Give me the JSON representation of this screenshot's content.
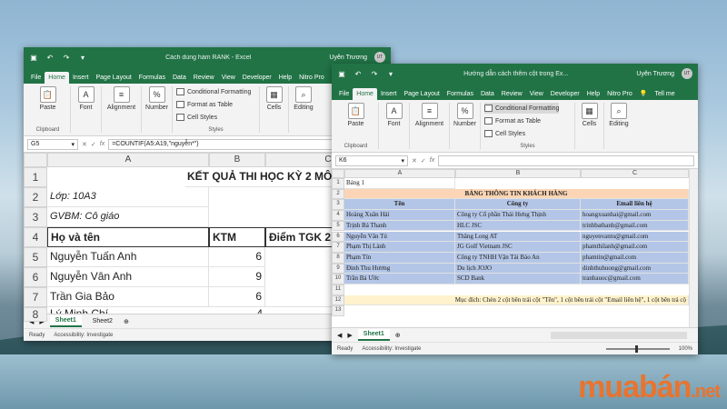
{
  "win1": {
    "title": "Cách dùng hàm RANK  -  Excel",
    "user": "Uyên Trương",
    "avatar": "UT",
    "tabs": [
      "File",
      "Home",
      "Insert",
      "Page Layout",
      "Formulas",
      "Data",
      "Review",
      "View",
      "Developer",
      "Help",
      "Nitro Pro"
    ],
    "ribbon": {
      "paste": "Paste",
      "clipboard": "Clipboard",
      "font": "Font",
      "alignment": "Alignment",
      "number": "Number",
      "cond": "Conditional Formatting",
      "fmt_table": "Format as Table",
      "cell_styles": "Cell Styles",
      "styles": "Styles",
      "cells": "Cells",
      "editing": "Editing"
    },
    "namebox": "G5",
    "formula": "=COUNTIF(A5:A19,\"nguyễn*\")",
    "cols": [
      "A",
      "B",
      "C"
    ],
    "rows": [
      "1",
      "2",
      "3",
      "4",
      "5",
      "6",
      "7",
      "8"
    ],
    "cells": {
      "title": "KẾT QUẢ THI HỌC KỲ 2 MÔ",
      "lop": "Lớp: 10A3",
      "gvbm": "GVBM: Cô giáo",
      "h_name": "Họ và tên",
      "h_ktm": "KTM",
      "h_gk": "Điểm TGK 2",
      "r5": "Nguyễn Tuấn Anh",
      "r5b": "6",
      "r6": "Nguyễn Vân Anh",
      "r6b": "9",
      "r7": "Trần Gia Bảo",
      "r7b": "6",
      "r7c": "1",
      "r8": "Lý Minh Chí",
      "r8b": "4"
    },
    "sheets": [
      "Sheet1",
      "Sheet2"
    ],
    "status": {
      "ready": "Ready",
      "access": "Accessibility: Investigate"
    }
  },
  "win2": {
    "title": "Hướng dẫn cách thêm cột trong Ex...",
    "user": "Uyên Trương",
    "avatar": "UT",
    "tabs": [
      "File",
      "Home",
      "Insert",
      "Page Layout",
      "Formulas",
      "Data",
      "Review",
      "View",
      "Developer",
      "Help",
      "Nitro Pro",
      "Tell me"
    ],
    "ribbon": {
      "paste": "Paste",
      "clipboard": "Clipboard",
      "font": "Font",
      "alignment": "Alignment",
      "number": "Number",
      "cond": "Conditional Formatting",
      "fmt_table": "Format as Table",
      "cell_styles": "Cell Styles",
      "styles": "Styles",
      "cells": "Cells",
      "editing": "Editing"
    },
    "namebox": "K6",
    "formula": "",
    "cols": [
      "A",
      "B",
      "C"
    ],
    "rows": [
      "1",
      "2",
      "3",
      "4",
      "5",
      "6",
      "7",
      "8",
      "9",
      "10",
      "11",
      "12",
      "13"
    ],
    "b1": "Bảng 1",
    "banner": "BẢNG THÔNG TIN KHÁCH HÀNG",
    "headers": [
      "Tên",
      "Công ty",
      "Email liên hệ"
    ],
    "data": [
      [
        "Hoàng Xuân Hải",
        "Công ty Cổ phần Thái Hưng Thịnh",
        "hoangxuanhai@gmail.com"
      ],
      [
        "Trịnh Bá Thanh",
        "HLC JSC",
        "trinhbathanh@gmail.com"
      ],
      [
        "Nguyễn Vân Tú",
        "Thăng Long AT",
        "nguyenvantu@gmail.com"
      ],
      [
        "Phạm Thị Lành",
        "JG Golf Vietnam JSC",
        "phamthilanh@gmail.com"
      ],
      [
        "Phạm Tín",
        "Công ty TNHH Vận Tải Bảo An",
        "phamtin@gmail.com"
      ],
      [
        "Đinh Thu Hương",
        "Du lịch JOJO",
        "dinhthuhuong@gmail.com"
      ],
      [
        "Trần Bá Ước",
        "SCD Bank",
        "tranbauoc@gmail.com"
      ]
    ],
    "note": "Mục đích: Chèn 2 cột bên trái cột \"Tên\", 1 cột bên trái cột \"Email liên hệ\", 1 cột bên trả cộ",
    "sheets": [
      "Sheet1"
    ],
    "status": {
      "ready": "Ready",
      "access": "Accessibility: Investigate",
      "zoom": "100%"
    }
  },
  "logo": {
    "brand": "muabán",
    "tld": ".net"
  },
  "colors": {
    "excel_green": "#217346",
    "banner": "#fbd5b5",
    "header_row": "#b4c6e7",
    "note_row": "#fff2cc",
    "logo": "#f36f21"
  }
}
